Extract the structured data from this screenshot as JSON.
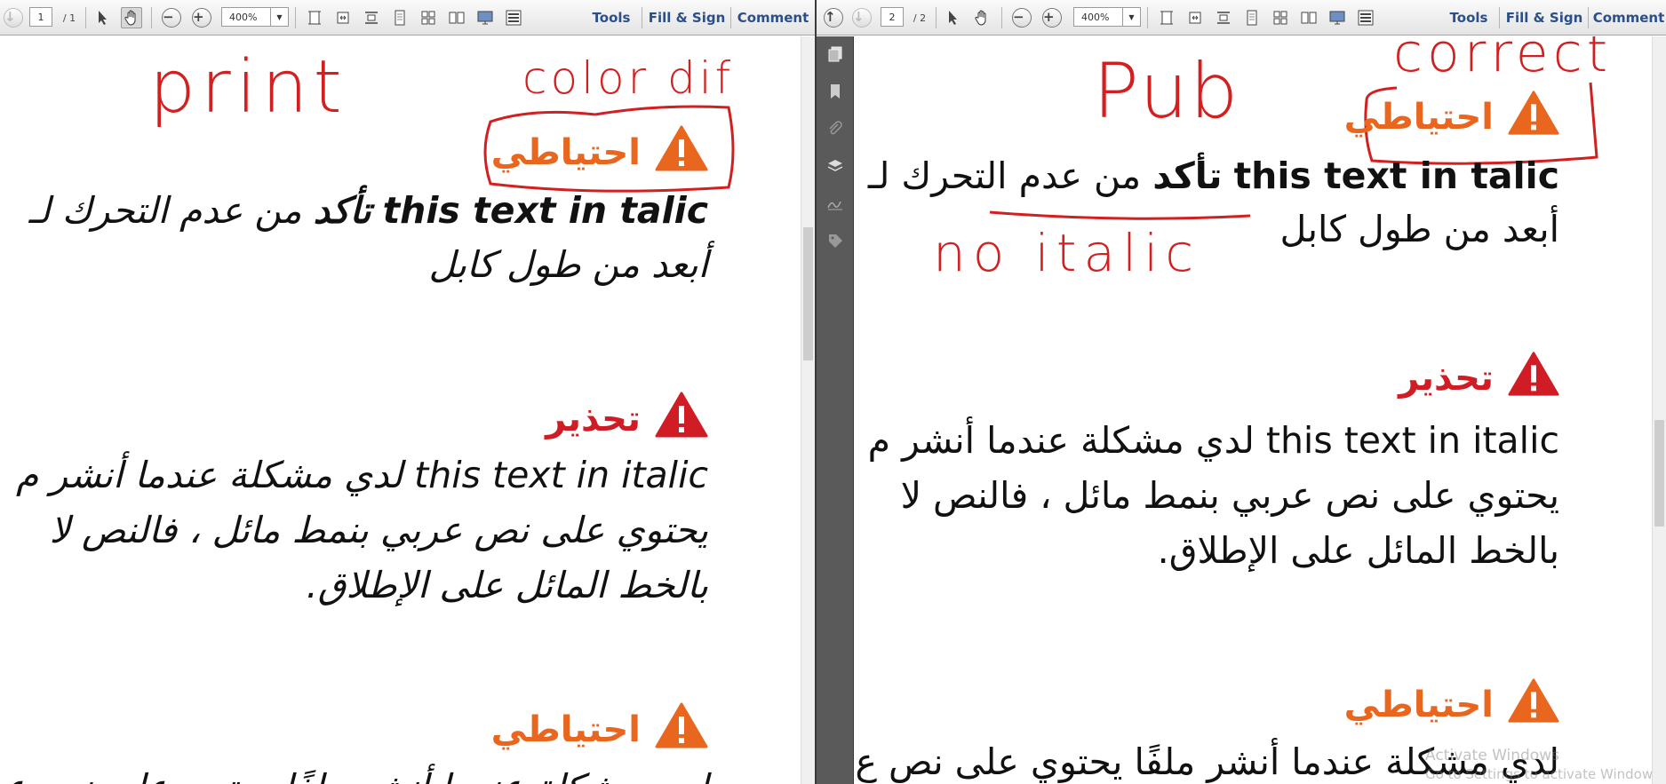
{
  "left_pane": {
    "toolbar": {
      "page_current": "1",
      "page_total": "/ 1",
      "zoom": "400%",
      "tools_label": "Tools",
      "fill_sign_label": "Fill & Sign",
      "comment_label": "Comment"
    },
    "doc": {
      "caution_1_heading": "احتياطي",
      "line_1": "this text in talic تأكد من عدم التحرك لـ",
      "line_1_en": "this text in talic",
      "line_1_ar_bold": "تأكد",
      "line_1_ar": "من عدم التحرك لـ",
      "line_2": "أبعد من طول كابل",
      "warning_heading": "تحذير",
      "para_1": "this text in italic لدي مشكلة عندما أنشر م",
      "para_1_en": "this text in italic",
      "para_1_ar": "لدي مشكلة عندما أنشر م",
      "para_2": "يحتوي على نص عربي بنمط مائل ، فالنص لا",
      "para_3": "بالخط المائل على الإطلاق.",
      "caution_2_heading": "احتياطي",
      "para_4": "لدي مشكلة عندما أنشر ملفًا يحتوي على نص ع"
    },
    "annotations": {
      "print": "print",
      "color_dif": "color dif"
    }
  },
  "right_pane": {
    "toolbar": {
      "page_current": "2",
      "page_total": "/ 2",
      "zoom": "400%",
      "tools_label": "Tools",
      "fill_sign_label": "Fill & Sign",
      "comment_label": "Comment"
    },
    "doc": {
      "caution_1_heading": "احتياطي",
      "line_1_en": "this text in talic",
      "line_1_ar_bold": "تأكد",
      "line_1_ar": "من عدم التحرك لـ",
      "line_2": "أبعد من طول كابل",
      "warning_heading": "تحذير",
      "para_1_en": "this text in italic",
      "para_1_ar": "لدي مشكلة عندما أنشر م",
      "para_2": "يحتوي على نص عربي بنمط مائل ، فالنص لا",
      "para_3": "بالخط المائل على الإطلاق.",
      "caution_2_heading": "احتياطي",
      "para_4": "لدي مشكلة عندما أنشر ملفًا يحتوي على نص ع"
    },
    "annotations": {
      "pub": "Pub",
      "correct": "correct",
      "no_italic": "no italic"
    },
    "watermark": {
      "line1": "Activate Windows",
      "line2": "Go to Settings to activate Windows."
    }
  },
  "colors": {
    "caution_orange": "#e8661e",
    "warning_red": "#d01c24",
    "annotation_red": "#d22020"
  }
}
